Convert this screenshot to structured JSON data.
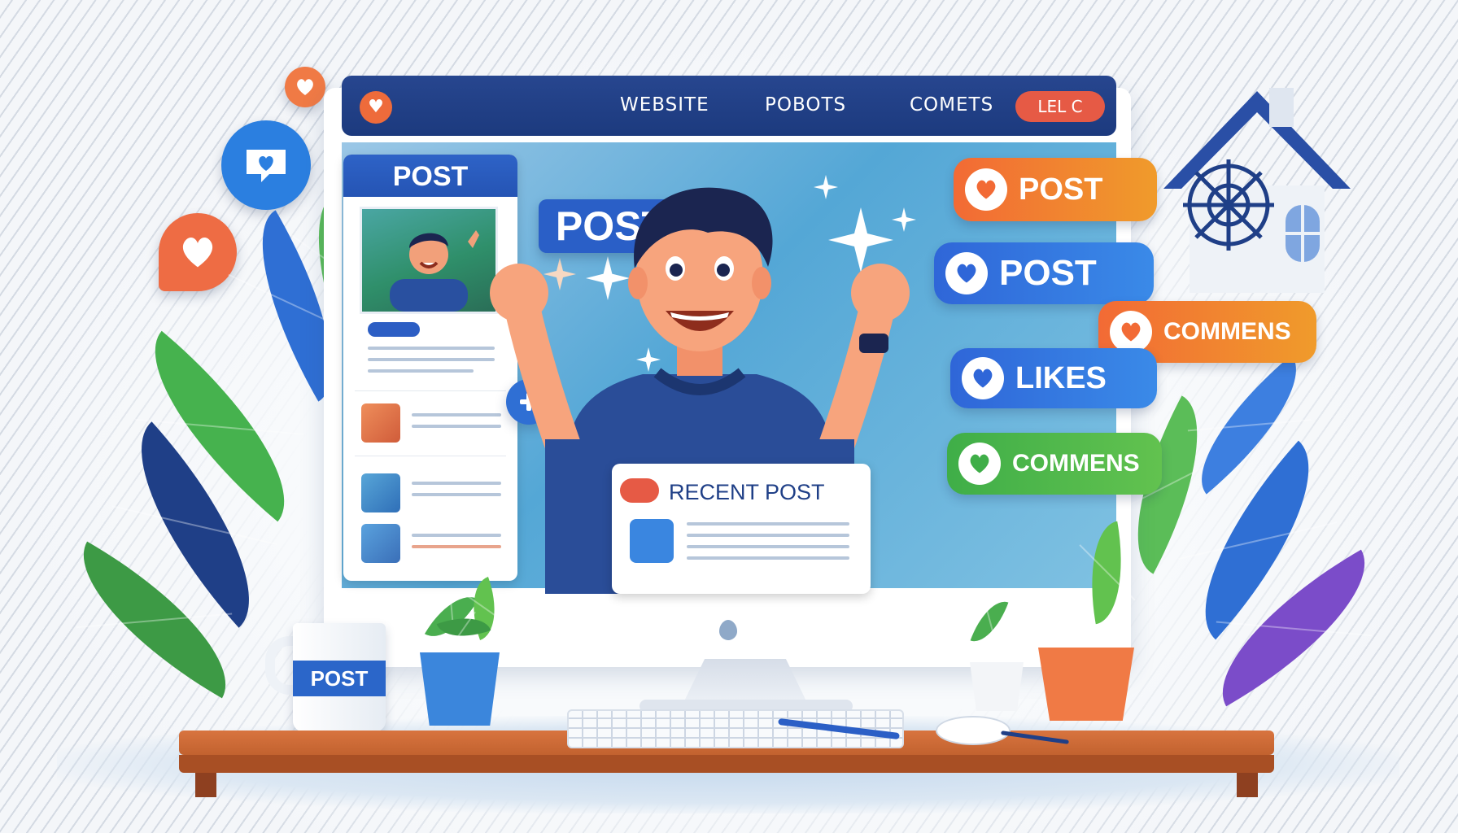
{
  "nav": {
    "links": [
      "WEBSITE",
      "POBOTS",
      "COMETS"
    ],
    "pill_label": "LEL C"
  },
  "sidebar": {
    "title": "POST"
  },
  "main": {
    "post_label": "POST",
    "recent_title": "RECENT POST"
  },
  "badges": [
    {
      "label": "POST",
      "color": "#f07a2a"
    },
    {
      "label": "POST",
      "color": "#2d6fe0"
    },
    {
      "label": "COMMENS",
      "color": "#f07a2a"
    },
    {
      "label": "LIKES",
      "color": "#2d6fe0"
    },
    {
      "label": "COMMENS",
      "color": "#48b649"
    }
  ],
  "mug": {
    "label": "POST"
  },
  "icons": [
    "heart-icon",
    "chat-heart-icon",
    "plus-icon",
    "home-icon",
    "sparkle-icon"
  ],
  "colors": {
    "brand_blue": "#2a5fc7",
    "nav_navy": "#1f3f87",
    "accent_orange": "#f07a2a",
    "accent_green": "#48b649",
    "desk_wood": "#d0693a"
  }
}
